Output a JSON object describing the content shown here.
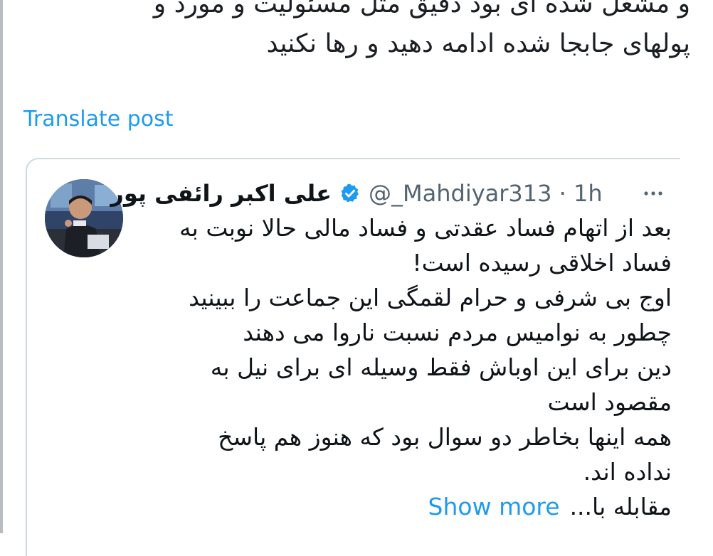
{
  "post": {
    "partial_top_line": "و مشغل شده ای بود دقیق مثل مسئولیت و مورد و",
    "second_line": "پولهای جابجا شده ادامه دهید و رها نکنید",
    "translate_label": "Translate post"
  },
  "quoted": {
    "author_name": "علی اکبر رائفی پور",
    "handle_time": "@_Mahdiyar313 · 1h",
    "body_lines": [
      "بعد از اتهام فساد عقدتی و فساد مالی حالا نوبت به",
      "فساد اخلاقی رسیده است!",
      "اوج بی شرفی و حرام لقمگی این جماعت را ببینید",
      "چطور به نوامیس مردم نسبت ناروا می دهند",
      "دین برای این اوباش فقط وسیله ای برای نیل به",
      "مقصود است",
      "همه اینها بخاطر دو سوال بود که هنوز هم پاسخ",
      "نداده اند.",
      "مقابله با..."
    ],
    "show_more_label": "Show more"
  },
  "icons": {
    "verified": "verified-badge-icon",
    "more": "more-options-icon"
  },
  "colors": {
    "accent": "#1d9bf0",
    "text": "#0f1419",
    "muted": "#536471",
    "border": "#cfd9de"
  }
}
